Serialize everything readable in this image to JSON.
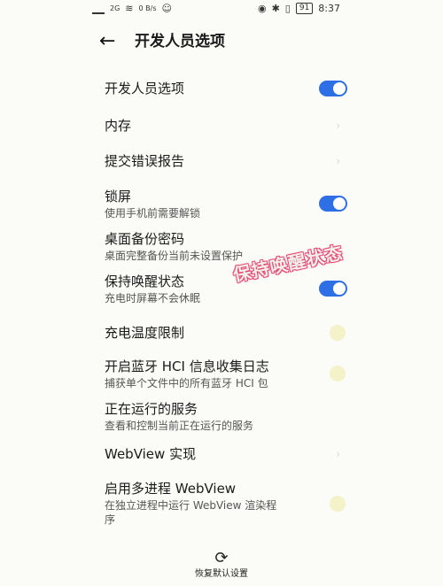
{
  "status_bar": {
    "network_type": "2G",
    "speed": "0\nB/s",
    "battery": "91",
    "time": "8:37"
  },
  "header": {
    "back_icon": "arrow-left-icon",
    "title": "开发人员选项"
  },
  "items": [
    {
      "label": "开发人员选项",
      "desc": "",
      "control": "toggle-on"
    },
    {
      "label": "内存",
      "desc": "",
      "control": "chevron"
    },
    {
      "label": "提交错误报告",
      "desc": "",
      "control": "chevron"
    },
    {
      "label": "锁屏",
      "desc": "使用手机前需要解锁",
      "control": "toggle-on"
    },
    {
      "label": "桌面备份密码",
      "desc": "桌面完整备份当前未设置保护",
      "control": "none"
    },
    {
      "label": "保持唤醒状态",
      "desc": "充电时屏幕不会休眠",
      "control": "toggle-on"
    },
    {
      "label": "充电温度限制",
      "desc": "",
      "control": "dot"
    },
    {
      "label": "开启蓝牙 HCI 信息收集日志",
      "desc": "捕获单个文件中的所有蓝牙 HCI 包",
      "control": "dot"
    },
    {
      "label": "正在运行的服务",
      "desc": "查看和控制当前正在运行的服务",
      "control": "none"
    },
    {
      "label": "WebView 实现",
      "desc": "",
      "control": "chevron"
    },
    {
      "label": "启用多进程 WebView",
      "desc": "在独立进程中运行 WebView 渲染程\n序",
      "control": "dot"
    }
  ],
  "sticker": "保持唤醒状态",
  "footer": {
    "restore_label": "恢复默认设置",
    "restore_icon": "refresh-icon"
  },
  "colors": {
    "toggle_on": "#2f6fe6",
    "background": "#fbfbf8"
  }
}
